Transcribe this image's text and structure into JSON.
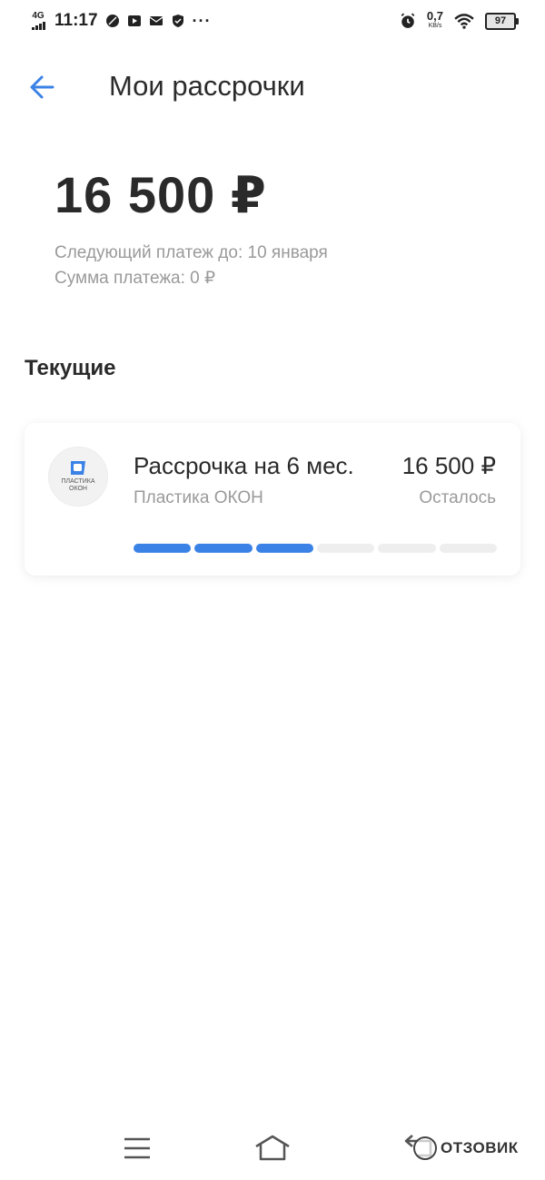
{
  "status_bar": {
    "network": "4G",
    "time": "11:17",
    "speed": "0,7",
    "speed_unit": "KB/s",
    "battery": "97",
    "more": "···"
  },
  "header": {
    "title": "Мои рассрочки"
  },
  "summary": {
    "amount": "16 500 ₽",
    "next_payment": "Следующий платеж до: 10 января",
    "payment_sum": "Сумма платежа: 0 ₽"
  },
  "section": {
    "title": "Текущие"
  },
  "installments": [
    {
      "title": "Рассрочка на 6 мес.",
      "merchant": "Пластика ОКОН",
      "logo_lines": [
        "ПЛАСТИКА",
        "ОКОН"
      ],
      "amount": "16 500 ₽",
      "amount_label": "Осталось",
      "progress_paid": 3,
      "progress_total": 6
    }
  ],
  "colors": {
    "accent": "#3b82e6",
    "text_primary": "#2a2a2a",
    "text_secondary": "#9a9a9a",
    "progress_empty": "#eeeeee"
  },
  "watermark": {
    "text": "ОТЗОВИК"
  }
}
